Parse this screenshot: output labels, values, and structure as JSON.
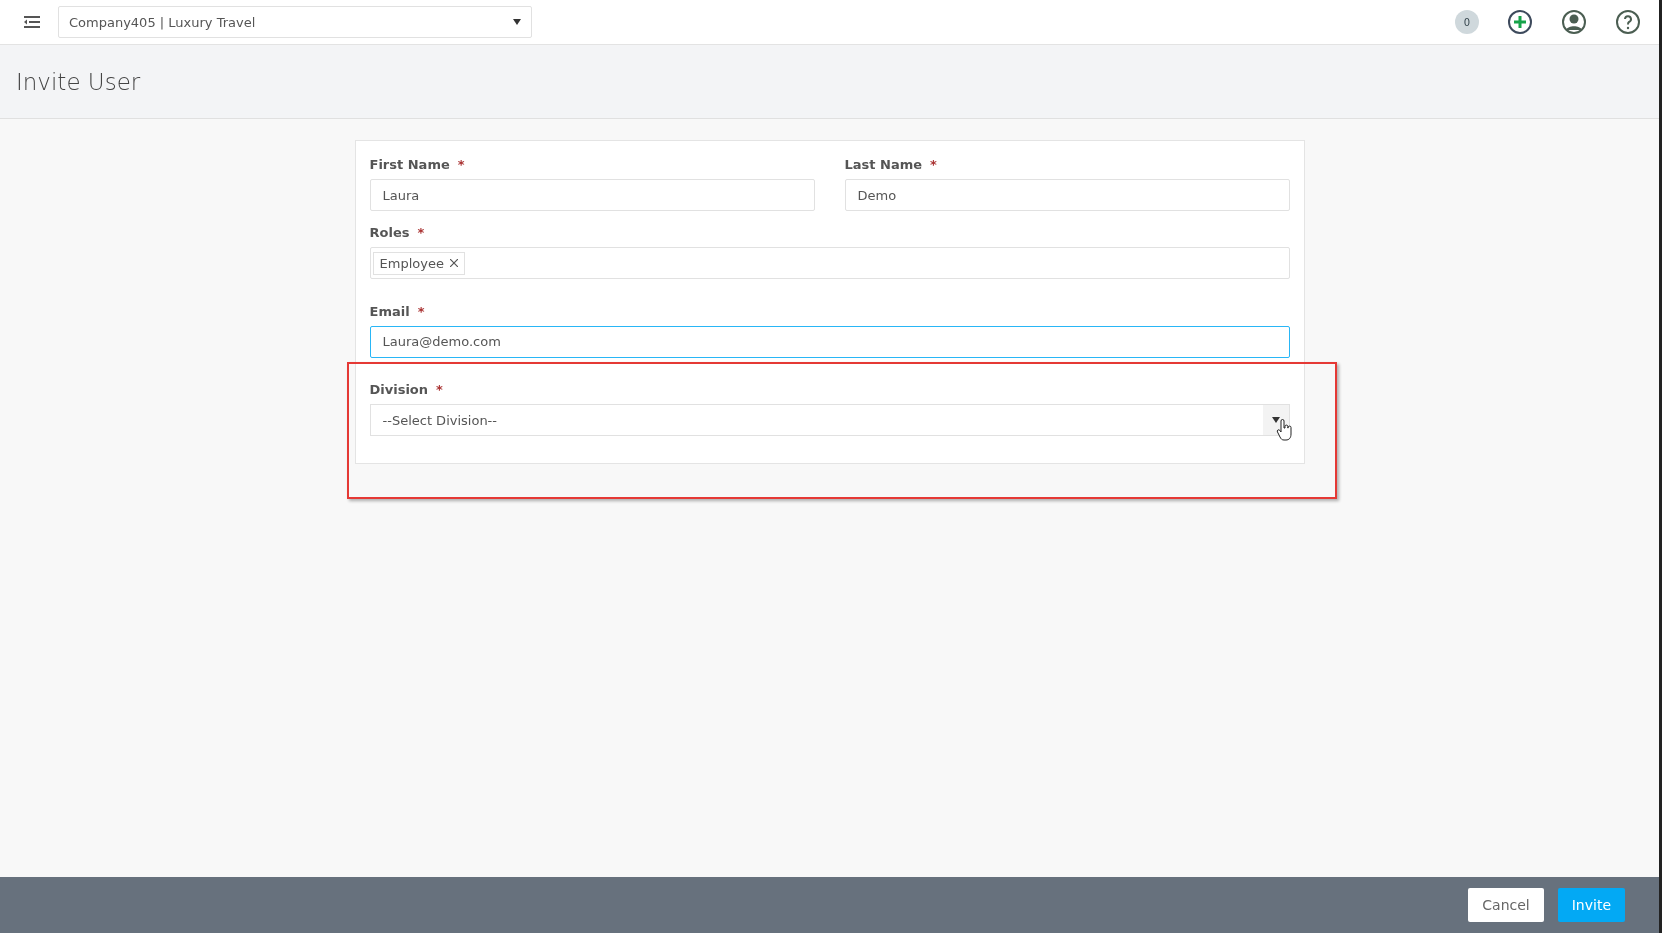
{
  "topbar": {
    "company_select": "Company405 | Luxury Travel",
    "notification_count": "0"
  },
  "page": {
    "title": "Invite User"
  },
  "form": {
    "first_name": {
      "label": "First Name",
      "required": "*",
      "value": "Laura"
    },
    "last_name": {
      "label": "Last Name",
      "required": "*",
      "value": "Demo"
    },
    "roles": {
      "label": "Roles",
      "required": "*",
      "tags": [
        "Employee"
      ]
    },
    "email": {
      "label": "Email",
      "required": "*",
      "value": "Laura@demo.com",
      "focused": true
    },
    "division": {
      "label": "Division",
      "required": "*",
      "placeholder": "--Select Division--",
      "highlighted": true
    }
  },
  "footer": {
    "buttons": [
      {
        "label": "Cancel",
        "kind": "secondary"
      },
      {
        "label": "Invite",
        "kind": "primary"
      }
    ]
  }
}
